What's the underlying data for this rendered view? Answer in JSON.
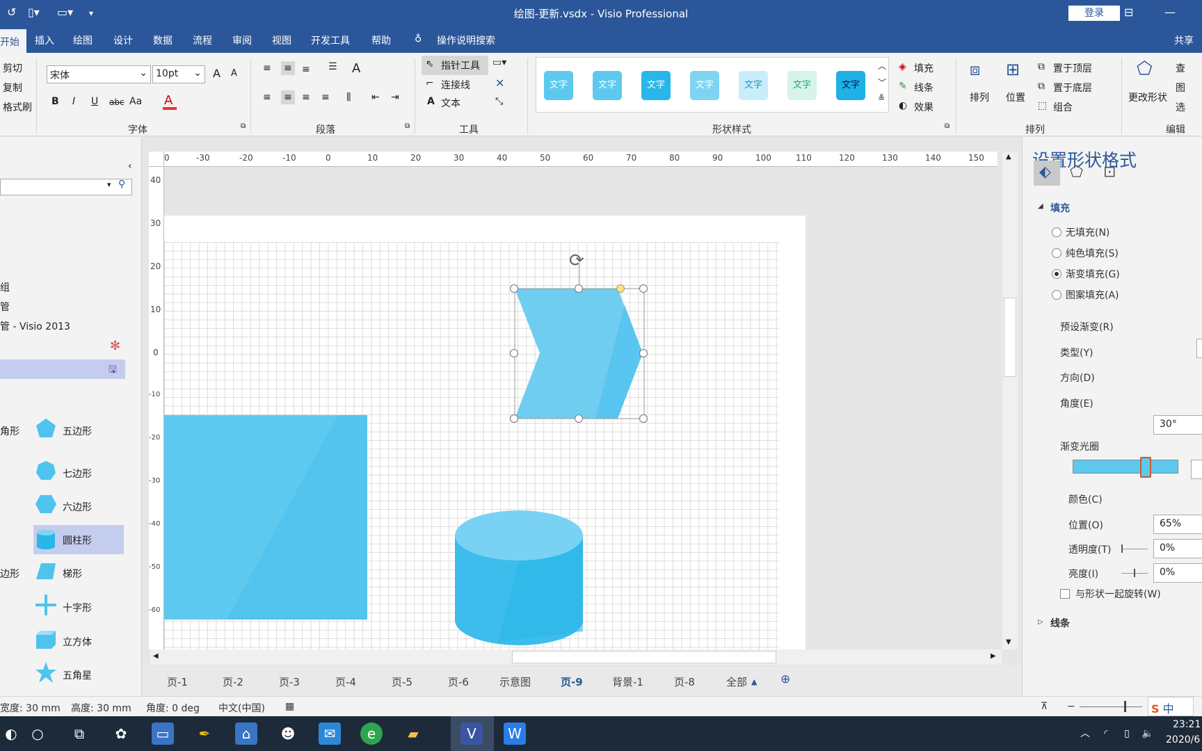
{
  "app": {
    "title": "绘图-更新.vsdx  -  Visio Professional",
    "login": "登录"
  },
  "tabs": [
    "开始",
    "插入",
    "绘图",
    "设计",
    "数据",
    "流程",
    "审阅",
    "视图",
    "开发工具",
    "帮助"
  ],
  "search_tab": "操作说明搜索",
  "share": "共享",
  "clipboard": {
    "cut": "剪切",
    "copy": "复制",
    "painter": "格式刷"
  },
  "font": {
    "name": "宋体",
    "size": "10pt",
    "group_label": "字体",
    "grow": "A",
    "shrink": "A",
    "bold": "B",
    "italic": "I",
    "underline": "U",
    "strike": "abc",
    "case": "Aa",
    "color": "A"
  },
  "paragraph": {
    "group_label": "段落"
  },
  "tools": {
    "pointer": "指针工具",
    "connector": "连接线",
    "text": "文本",
    "group_label": "工具"
  },
  "shape_styles": {
    "swatch_text": "文字",
    "group_label": "形状样式",
    "fill": "填充",
    "line": "线条",
    "effect": "效果"
  },
  "arrange": {
    "arrange": "排列",
    "position": "位置",
    "bring_front": "置于顶层",
    "send_back": "置于底层",
    "group": "组合",
    "group_label": "排列"
  },
  "edit": {
    "change_shape": "更改形状",
    "find": "查",
    "layer": "图",
    "select": "选",
    "group_label": "编辑"
  },
  "shapes_pane": {
    "header_items": [
      "组",
      "管",
      "管 - Visio 2013"
    ],
    "shapes": [
      {
        "left_label": "角形",
        "label": "五边形"
      },
      {
        "label": "七边形"
      },
      {
        "label": "六边形"
      },
      {
        "label": "圆柱形"
      },
      {
        "left_label": "边形",
        "label": "梯形"
      },
      {
        "label": "十字形"
      },
      {
        "label": "立方体"
      },
      {
        "label": "五角星"
      }
    ]
  },
  "hruler_ticks": [
    "0",
    "-30",
    "-20",
    "-10",
    "0",
    "10",
    "20",
    "30",
    "40",
    "50",
    "60",
    "70",
    "80",
    "90",
    "100",
    "110",
    "120",
    "130",
    "140",
    "150"
  ],
  "vruler_ticks": [
    "40",
    "30",
    "20",
    "10",
    "0",
    "-10",
    "-20",
    "-30",
    "-40",
    "-50",
    "-60"
  ],
  "page_tabs": [
    "页-1",
    "页-2",
    "页-3",
    "页-4",
    "页-5",
    "页-6",
    "示意图",
    "页-9",
    "背景-1",
    "页-8",
    "全部"
  ],
  "active_page": "页-9",
  "format_pane": {
    "title": "设置形状格式",
    "fill_section": "填充",
    "options": [
      "无填充(N)",
      "纯色填充(S)",
      "渐变填充(G)",
      "图案填充(A)"
    ],
    "selected_option": "渐变填充(G)",
    "preset": "预设渐变(R)",
    "type": "类型(Y)",
    "direction": "方向(D)",
    "angle_label": "角度(E)",
    "angle_value": "30°",
    "stops_label": "渐变光圈",
    "color_label": "颜色(C)",
    "position_label": "位置(O)",
    "position_value": "65%",
    "transparency_label": "透明度(T)",
    "transparency_value": "0%",
    "brightness_label": "亮度(I)",
    "brightness_value": "0%",
    "rotate_with_shape": "与形状一起旋转(W)",
    "line_section": "线条"
  },
  "status": {
    "width": "宽度: 30 mm",
    "height": "高度: 30 mm",
    "angle": "角度: 0 deg",
    "language": "中文(中国)"
  },
  "taskbar": {
    "time": "23:21",
    "date": "2020/6",
    "ime": "中"
  },
  "colors": {
    "accent": "#2b579a",
    "shape_fill": "#5ec9ef",
    "shape_fill_dark": "#29b6e8"
  }
}
